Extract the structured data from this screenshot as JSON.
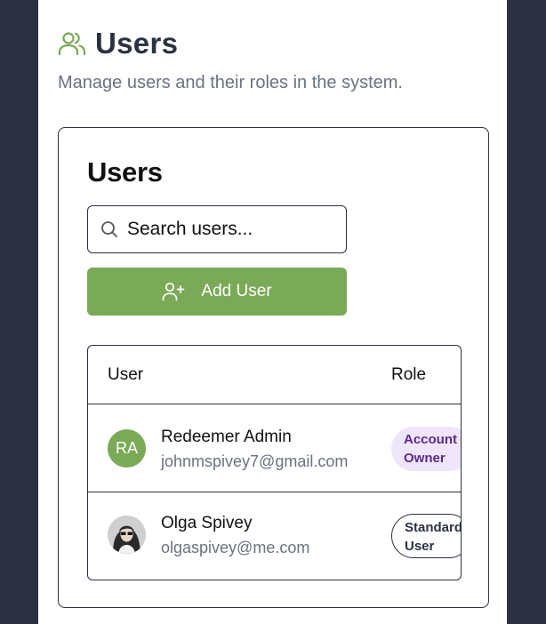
{
  "page": {
    "title": "Users",
    "subtitle": "Manage users and their roles in the system.",
    "accent_color": "#7aaa57",
    "header_icon": "users-icon"
  },
  "card": {
    "title": "Users",
    "search": {
      "placeholder": "Search users...",
      "value": "",
      "icon": "search-icon"
    },
    "add_button": {
      "label": "Add User",
      "icon": "user-plus-icon"
    }
  },
  "table": {
    "columns": [
      "User",
      "Role"
    ],
    "rows": [
      {
        "initials": "RA",
        "name": "Redeemer Admin",
        "email": "johnmspivey7@gmail.com",
        "role": "Account\nOwner",
        "role_color": "#5b2a91",
        "avatar": "initials"
      },
      {
        "initials": "",
        "name": "Olga Spivey",
        "email": "olgaspivey@me.com",
        "role": "Standard\nUser",
        "role_color": "#2c3142",
        "avatar": "photo"
      }
    ]
  }
}
